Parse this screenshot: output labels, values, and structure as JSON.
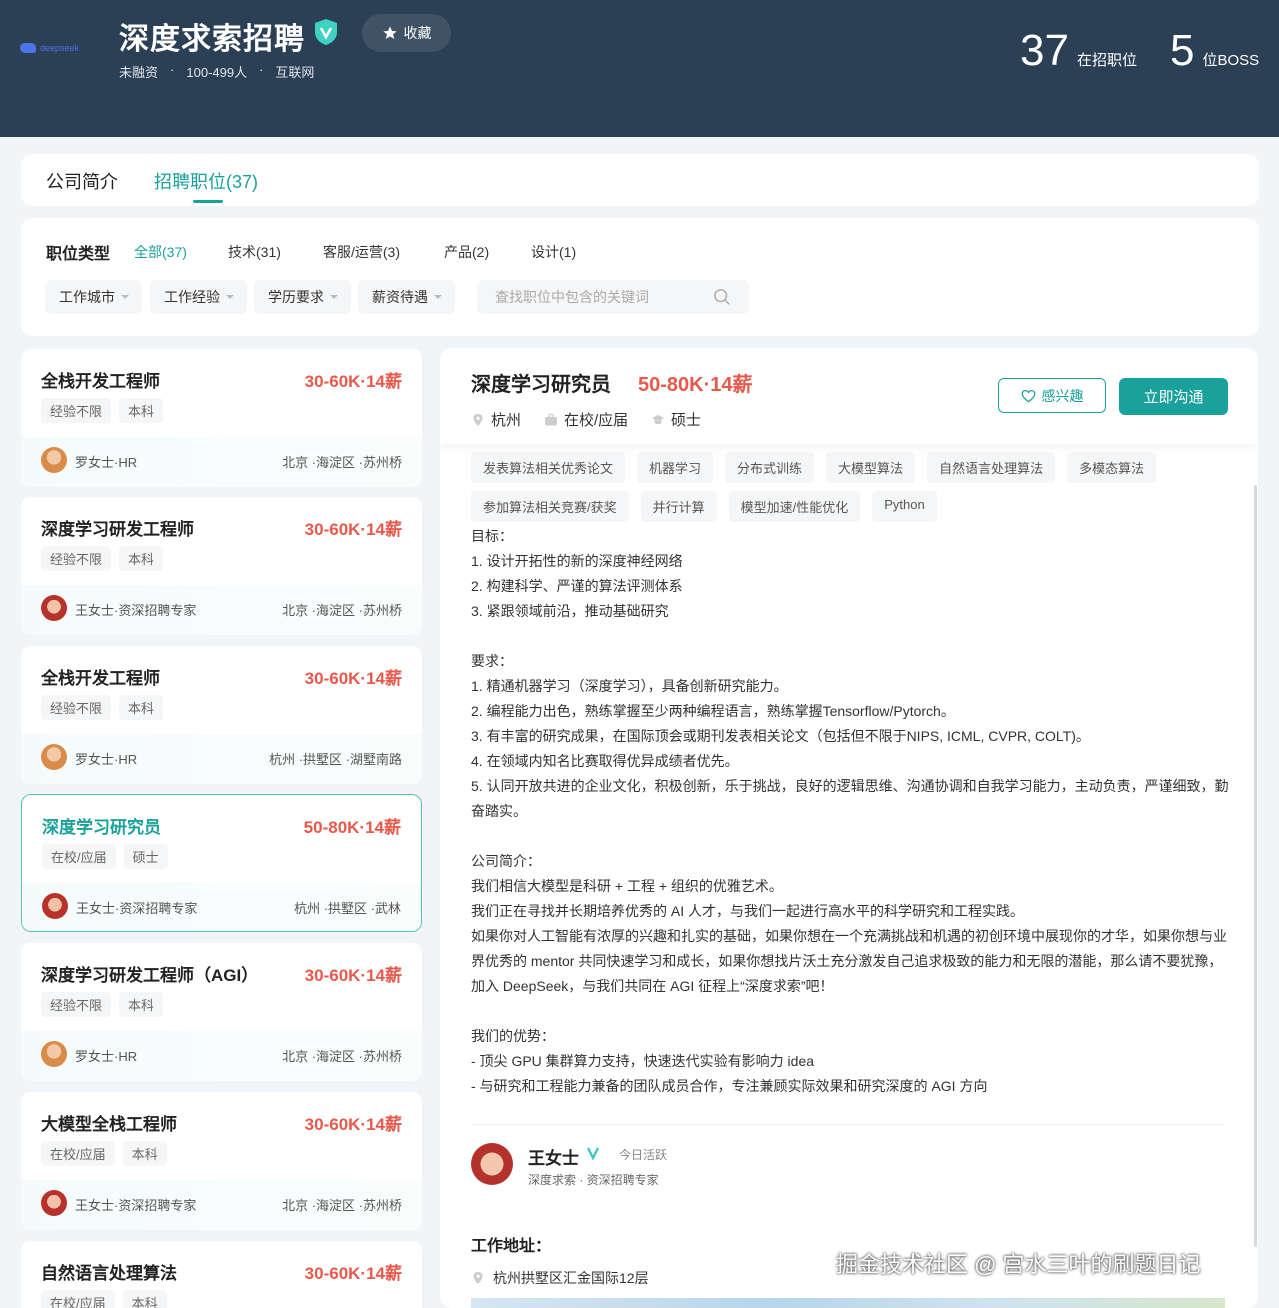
{
  "header": {
    "logo_text": "deepseek",
    "company_name": "深度求索招聘",
    "fav_label": "收藏",
    "meta": [
      "未融资",
      "100-499人",
      "互联网"
    ],
    "stats": [
      {
        "num": "37",
        "label": "在招职位"
      },
      {
        "num": "5",
        "label": "位BOSS"
      }
    ]
  },
  "tabs": [
    {
      "label": "公司简介"
    },
    {
      "label": "招聘职位(37)"
    }
  ],
  "filters": {
    "title": "职位类型",
    "categories": [
      "全部(37)",
      "技术(31)",
      "客服/运营(3)",
      "产品(2)",
      "设计(1)"
    ],
    "dropdowns": [
      "工作城市",
      "工作经验",
      "学历要求",
      "薪资待遇"
    ],
    "search_placeholder": "查找职位中包含的关键词"
  },
  "jobs": [
    {
      "title": "全栈开发工程师",
      "salary": "30-60K·14薪",
      "tags": [
        "经验不限",
        "本科"
      ],
      "recruiter": "罗女士·HR",
      "location": "北京 ·海淀区 ·苏州桥"
    },
    {
      "title": "深度学习研发工程师",
      "salary": "30-60K·14薪",
      "tags": [
        "经验不限",
        "本科"
      ],
      "recruiter": "王女士·资深招聘专家",
      "location": "北京 ·海淀区 ·苏州桥"
    },
    {
      "title": "全栈开发工程师",
      "salary": "30-60K·14薪",
      "tags": [
        "经验不限",
        "本科"
      ],
      "recruiter": "罗女士·HR",
      "location": "杭州 ·拱墅区 ·湖墅南路"
    },
    {
      "title": "深度学习研究员",
      "salary": "50-80K·14薪",
      "tags": [
        "在校/应届",
        "硕士"
      ],
      "recruiter": "王女士·资深招聘专家",
      "location": "杭州 ·拱墅区 ·武林"
    },
    {
      "title": "深度学习研发工程师（AGI）",
      "salary": "30-60K·14薪",
      "tags": [
        "经验不限",
        "本科"
      ],
      "recruiter": "罗女士·HR",
      "location": "北京 ·海淀区 ·苏州桥"
    },
    {
      "title": "大模型全栈工程师",
      "salary": "30-60K·14薪",
      "tags": [
        "在校/应届",
        "本科"
      ],
      "recruiter": "王女士·资深招聘专家",
      "location": "北京 ·海淀区 ·苏州桥"
    },
    {
      "title": "自然语言处理算法",
      "salary": "30-60K·14薪",
      "tags": [
        "在校/应届",
        "本科"
      ],
      "recruiter": "",
      "location": ""
    }
  ],
  "detail": {
    "title": "深度学习研究员",
    "salary": "50-80K·14薪",
    "city": "杭州",
    "experience": "在校/应届",
    "degree": "硕士",
    "interest_label": "感兴趣",
    "chat_label": "立即沟通",
    "skills": [
      "发表算法相关优秀论文",
      "机器学习",
      "分布式训练",
      "大模型算法",
      "自然语言处理算法",
      "多模态算法",
      "参加算法相关竞赛/获奖",
      "并行计算",
      "模型加速/性能优化",
      "Python"
    ],
    "description": [
      "目标：",
      "1. 设计开拓性的新的深度神经网络",
      "2. 构建科学、严谨的算法评测体系",
      "3. 紧跟领域前沿，推动基础研究",
      "",
      "要求：",
      "1. 精通机器学习（深度学习），具备创新研究能力。",
      "2. 编程能力出色，熟练掌握至少两种编程语言，熟练掌握Tensorflow/Pytorch。",
      "3. 有丰富的研究成果，在国际顶会或期刊发表相关论文（包括但不限于NIPS, ICML, CVPR, COLT)。",
      "4. 在领域内知名比赛取得优异成绩者优先。",
      "5. 认同开放共进的企业文化，积极创新，乐于挑战，良好的逻辑思维、沟通协调和自我学习能力，主动负责，严谨细致，勤奋踏实。",
      "",
      "公司简介：",
      "我们相信大模型是科研 + 工程 + 组织的优雅艺术。",
      "我们正在寻找并长期培养优秀的 AI 人才，与我们一起进行高水平的科学研究和工程实践。",
      "如果你对人工智能有浓厚的兴趣和扎实的基础，如果你想在一个充满挑战和机遇的初创环境中展现你的才华，如果你想与业界优秀的 mentor 共同快速学习和成长，如果你想找片沃土充分激发自己追求极致的能力和无限的潜能，那么请不要犹豫，加入 DeepSeek，与我们共同在 AGI 征程上“深度求索”吧！",
      "",
      "我们的优势：",
      "- 顶尖 GPU 集群算力支持，快速迭代实验有影响力 idea",
      "- 与研究和工程能力兼备的团队成员合作，专注兼顾实际效果和研究深度的 AGI 方向"
    ],
    "hr": {
      "name": "王女士",
      "active": "今日活跃",
      "role": "深度求索 · 资深招聘专家"
    },
    "address_title": "工作地址：",
    "address": "杭州拱墅区汇金国际12层"
  },
  "watermark": "掘金技术社区 @ 宫水三叶的刷题日记",
  "colors": {
    "header_bg": "#2b3f55",
    "accent": "#1aa19b",
    "salary": "#e8594c"
  }
}
